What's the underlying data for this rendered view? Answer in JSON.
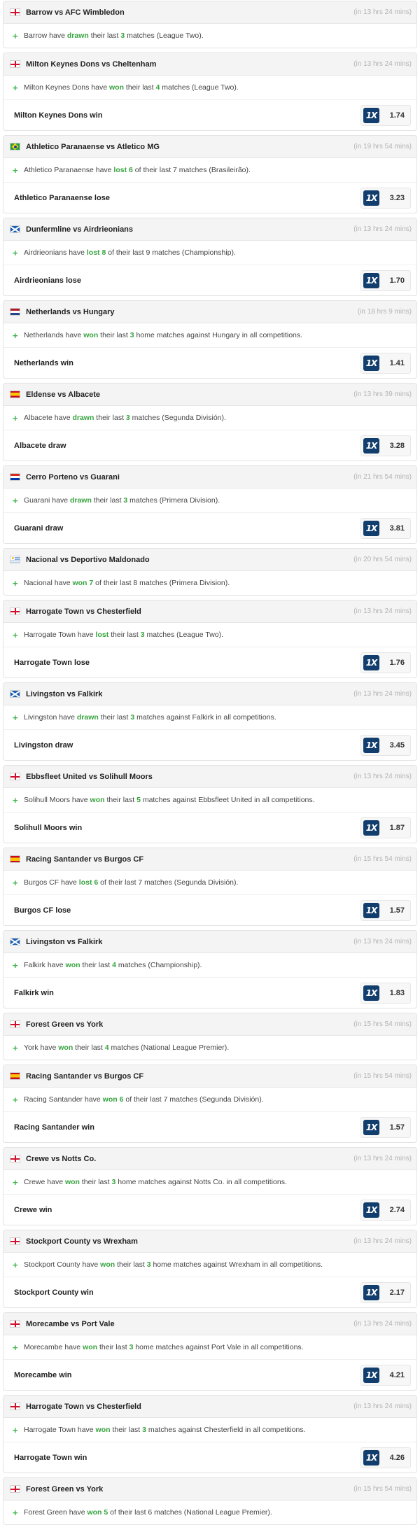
{
  "book": {
    "logo_text": "1X",
    "brand_color": "#123e6e"
  },
  "colors": {
    "accent": "#37a33f",
    "muted": "#b3b3b3"
  },
  "items": [
    {
      "flag": "eng",
      "fixture": "Barrow vs AFC Wimbledon",
      "kickoff": "(in 13 hrs 24 mins)",
      "stat": {
        "a": "Barrow have ",
        "hl": "drawn",
        "b": " their last ",
        "n": "3",
        "c": " matches (League Two)."
      }
    },
    {
      "flag": "eng",
      "fixture": "Milton Keynes Dons vs Cheltenham",
      "kickoff": "(in 13 hrs 24 mins)",
      "stat": {
        "a": "Milton Keynes Dons have ",
        "hl": "won",
        "b": " their last ",
        "n": "4",
        "c": " matches (League Two)."
      },
      "bet": {
        "label": "Milton Keynes Dons win",
        "odds": "1.74"
      }
    },
    {
      "flag": "bra",
      "fixture": "Athletico Paranaense vs Atletico MG",
      "kickoff": "(in 19 hrs 54 mins)",
      "stat": {
        "a": "Athletico Paranaense have ",
        "hl": "lost 6",
        "b": " of their last 7 matches (Brasileirão).",
        "n": "",
        "c": ""
      },
      "bet": {
        "label": "Athletico Paranaense lose",
        "odds": "3.23"
      }
    },
    {
      "flag": "sco",
      "fixture": "Dunfermline vs Airdrieonians",
      "kickoff": "(in 13 hrs 24 mins)",
      "stat": {
        "a": "Airdrieonians have ",
        "hl": "lost 8",
        "b": " of their last 9 matches (Championship).",
        "n": "",
        "c": ""
      },
      "bet": {
        "label": "Airdrieonians lose",
        "odds": "1.70"
      }
    },
    {
      "flag": "ned",
      "fixture": "Netherlands vs Hungary",
      "kickoff": "(in 18 hrs 9 mins)",
      "stat": {
        "a": "Netherlands have ",
        "hl": "won",
        "b": " their last ",
        "n": "3",
        "c": " home matches against Hungary in all competitions."
      },
      "bet": {
        "label": "Netherlands win",
        "odds": "1.41"
      }
    },
    {
      "flag": "esp",
      "fixture": "Eldense vs Albacete",
      "kickoff": "(in 13 hrs 39 mins)",
      "stat": {
        "a": "Albacete have ",
        "hl": "drawn",
        "b": " their last ",
        "n": "3",
        "c": " matches (Segunda División)."
      },
      "bet": {
        "label": "Albacete draw",
        "odds": "3.28"
      }
    },
    {
      "flag": "par",
      "fixture": "Cerro Porteno vs Guarani",
      "kickoff": "(in 21 hrs 54 mins)",
      "stat": {
        "a": "Guarani have ",
        "hl": "drawn",
        "b": " their last ",
        "n": "3",
        "c": " matches (Primera Division)."
      },
      "bet": {
        "label": "Guarani draw",
        "odds": "3.81"
      }
    },
    {
      "flag": "uru",
      "fixture": "Nacional vs Deportivo Maldonado",
      "kickoff": "(in 20 hrs 54 mins)",
      "stat": {
        "a": "Nacional have ",
        "hl": "won 7",
        "b": " of their last 8 matches (Primera Division).",
        "n": "",
        "c": ""
      }
    },
    {
      "flag": "eng",
      "fixture": "Harrogate Town vs Chesterfield",
      "kickoff": "(in 13 hrs 24 mins)",
      "stat": {
        "a": "Harrogate Town have ",
        "hl": "lost",
        "b": " their last ",
        "n": "3",
        "c": " matches (League Two)."
      },
      "bet": {
        "label": "Harrogate Town lose",
        "odds": "1.76"
      }
    },
    {
      "flag": "sco",
      "fixture": "Livingston vs Falkirk",
      "kickoff": "(in 13 hrs 24 mins)",
      "stat": {
        "a": "Livingston have ",
        "hl": "drawn",
        "b": " their last ",
        "n": "3",
        "c": " matches against Falkirk in all competitions."
      },
      "bet": {
        "label": "Livingston draw",
        "odds": "3.45"
      }
    },
    {
      "flag": "eng",
      "fixture": "Ebbsfleet United vs Solihull Moors",
      "kickoff": "(in 13 hrs 24 mins)",
      "stat": {
        "a": "Solihull Moors have ",
        "hl": "won",
        "b": " their last ",
        "n": "5",
        "c": " matches against Ebbsfleet United in all competitions."
      },
      "bet": {
        "label": "Solihull Moors win",
        "odds": "1.87"
      }
    },
    {
      "flag": "esp",
      "fixture": "Racing Santander vs Burgos CF",
      "kickoff": "(in 15 hrs 54 mins)",
      "stat": {
        "a": "Burgos CF have ",
        "hl": "lost 6",
        "b": " of their last 7 matches (Segunda División).",
        "n": "",
        "c": ""
      },
      "bet": {
        "label": "Burgos CF lose",
        "odds": "1.57"
      }
    },
    {
      "flag": "sco",
      "fixture": "Livingston vs Falkirk",
      "kickoff": "(in 13 hrs 24 mins)",
      "stat": {
        "a": "Falkirk have ",
        "hl": "won",
        "b": " their last ",
        "n": "4",
        "c": " matches (Championship)."
      },
      "bet": {
        "label": "Falkirk win",
        "odds": "1.83"
      }
    },
    {
      "flag": "eng",
      "fixture": "Forest Green vs York",
      "kickoff": "(in 15 hrs 54 mins)",
      "stat": {
        "a": "York have ",
        "hl": "won",
        "b": " their last ",
        "n": "4",
        "c": " matches (National League Premier)."
      }
    },
    {
      "flag": "esp",
      "fixture": "Racing Santander vs Burgos CF",
      "kickoff": "(in 15 hrs 54 mins)",
      "stat": {
        "a": "Racing Santander have ",
        "hl": "won 6",
        "b": " of their last 7 matches (Segunda División).",
        "n": "",
        "c": ""
      },
      "bet": {
        "label": "Racing Santander win",
        "odds": "1.57"
      }
    },
    {
      "flag": "eng",
      "fixture": "Crewe vs Notts Co.",
      "kickoff": "(in 13 hrs 24 mins)",
      "stat": {
        "a": "Crewe have ",
        "hl": "won",
        "b": " their last ",
        "n": "3",
        "c": " home matches against Notts Co. in all competitions."
      },
      "bet": {
        "label": "Crewe win",
        "odds": "2.74"
      }
    },
    {
      "flag": "eng",
      "fixture": "Stockport County vs Wrexham",
      "kickoff": "(in 13 hrs 24 mins)",
      "stat": {
        "a": "Stockport County have ",
        "hl": "won",
        "b": " their last ",
        "n": "3",
        "c": " home matches against Wrexham in all competitions."
      },
      "bet": {
        "label": "Stockport County win",
        "odds": "2.17"
      }
    },
    {
      "flag": "eng",
      "fixture": "Morecambe vs Port Vale",
      "kickoff": "(in 13 hrs 24 mins)",
      "stat": {
        "a": "Morecambe have ",
        "hl": "won",
        "b": " their last ",
        "n": "3",
        "c": " home matches against Port Vale in all competitions."
      },
      "bet": {
        "label": "Morecambe win",
        "odds": "4.21"
      }
    },
    {
      "flag": "eng",
      "fixture": "Harrogate Town vs Chesterfield",
      "kickoff": "(in 13 hrs 24 mins)",
      "stat": {
        "a": "Harrogate Town have ",
        "hl": "won",
        "b": " their last ",
        "n": "3",
        "c": " matches against Chesterfield in all competitions."
      },
      "bet": {
        "label": "Harrogate Town win",
        "odds": "4.26"
      }
    },
    {
      "flag": "eng",
      "fixture": "Forest Green vs York",
      "kickoff": "(in 15 hrs 54 mins)",
      "stat": {
        "a": "Forest Green have ",
        "hl": "won 5",
        "b": " of their last 6 matches (National League Premier).",
        "n": "",
        "c": ""
      }
    }
  ]
}
